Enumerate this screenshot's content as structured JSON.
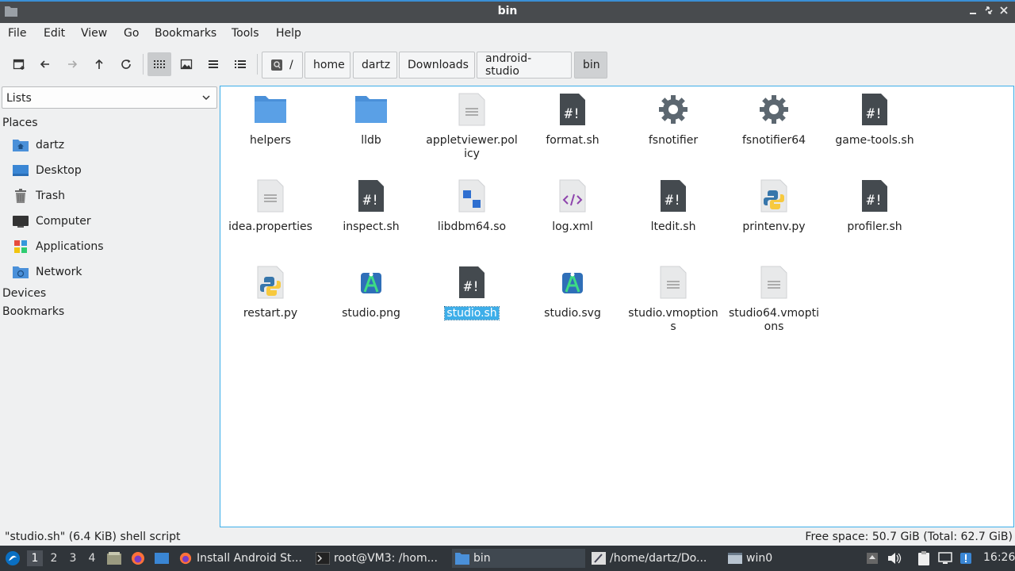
{
  "window": {
    "title": "bin"
  },
  "menu": [
    "File",
    "Edit",
    "View",
    "Go",
    "Bookmarks",
    "Tools",
    "Help"
  ],
  "breadcrumb": {
    "root_label": "/",
    "parts": [
      "home",
      "dartz",
      "Downloads",
      "android-studio",
      "bin"
    ]
  },
  "sidebar": {
    "selector_value": "Lists",
    "places_header": "Places",
    "places": [
      "dartz",
      "Desktop",
      "Trash",
      "Computer",
      "Applications",
      "Network"
    ],
    "devices_header": "Devices",
    "bookmarks_header": "Bookmarks"
  },
  "files": [
    {
      "name": "helpers",
      "icon": "folder-icon"
    },
    {
      "name": "lldb",
      "icon": "folder-icon"
    },
    {
      "name": "appletviewer.policy",
      "icon": "text-file-icon"
    },
    {
      "name": "format.sh",
      "icon": "shell-script-icon"
    },
    {
      "name": "fsnotifier",
      "icon": "executable-gear-icon"
    },
    {
      "name": "fsnotifier64",
      "icon": "executable-gear-icon"
    },
    {
      "name": "game-tools.sh",
      "icon": "shell-script-icon"
    },
    {
      "name": "idea.properties",
      "icon": "text-file-icon"
    },
    {
      "name": "inspect.sh",
      "icon": "shell-script-icon"
    },
    {
      "name": "libdbm64.so",
      "icon": "shared-library-icon"
    },
    {
      "name": "log.xml",
      "icon": "xml-file-icon"
    },
    {
      "name": "ltedit.sh",
      "icon": "shell-script-icon"
    },
    {
      "name": "printenv.py",
      "icon": "python-file-icon"
    },
    {
      "name": "profiler.sh",
      "icon": "shell-script-icon"
    },
    {
      "name": "restart.py",
      "icon": "python-file-icon"
    },
    {
      "name": "studio.png",
      "icon": "android-studio-icon"
    },
    {
      "name": "studio.sh",
      "icon": "shell-script-icon",
      "selected": true
    },
    {
      "name": "studio.svg",
      "icon": "android-studio-icon"
    },
    {
      "name": "studio.vmoptions",
      "icon": "text-file-icon"
    },
    {
      "name": "studio64.vmoptions",
      "icon": "text-file-icon"
    }
  ],
  "status": {
    "left": "\"studio.sh\" (6.4 KiB) shell script",
    "right": "Free space: 50.7 GiB (Total: 62.7 GiB)"
  },
  "taskbar": {
    "workspaces": [
      "1",
      "2",
      "3",
      "4"
    ],
    "current_workspace": "1",
    "tasks": [
      {
        "label": "Install Android St...",
        "icon": "firefox-icon"
      },
      {
        "label": "root@VM3: /hom...",
        "icon": "terminal-icon"
      },
      {
        "label": "bin",
        "icon": "folder-icon",
        "active": true
      },
      {
        "label": "/home/dartz/Do...",
        "icon": "text-editor-icon"
      },
      {
        "label": "win0",
        "icon": "window-icon"
      }
    ],
    "clock": "16:26"
  },
  "colors": {
    "accent": "#3daee9",
    "folder": "#4a90d9",
    "script_dark": "#444a4f",
    "taskbar_bg": "#30353a",
    "titlebar_bg": "#484b4e"
  }
}
